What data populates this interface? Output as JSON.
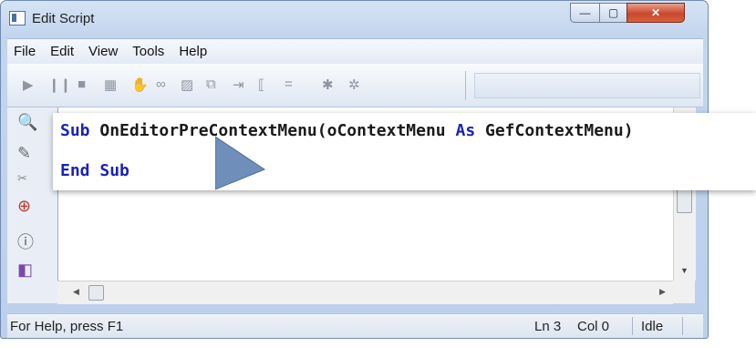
{
  "window": {
    "title": "Edit Script"
  },
  "menubar": {
    "items": [
      "File",
      "Edit",
      "View",
      "Tools",
      "Help"
    ]
  },
  "toolbar": {
    "icons": [
      "play-icon",
      "pause-icon",
      "stop-icon",
      "calendar-icon",
      "hand-icon",
      "glasses-icon",
      "picture-icon",
      "hierarchy-icon",
      "step-into-icon",
      "step-over-icon",
      "equals-icon",
      "bug-icon",
      "bug-off-icon"
    ]
  },
  "leftstrip": {
    "icons": [
      "search-icon",
      "pencil-icon",
      "scissors-icon",
      "add-variable-icon",
      "info-icon",
      "paint-icon"
    ]
  },
  "code": {
    "line1": {
      "kw1": "Sub",
      "name": " OnEditorPreContextMenu(oContextMenu ",
      "kw2": "As",
      "type": " GefContextMenu)"
    },
    "line2": {
      "kw1": "End",
      "kw2": " Sub"
    }
  },
  "statusbar": {
    "help": "For Help, press F1",
    "ln": "Ln  3",
    "col": "Col  0",
    "idle": "Idle"
  },
  "colors": {
    "keyword": "#1a22b8",
    "cursor": "#6f8fba",
    "close": "#c9482d"
  }
}
